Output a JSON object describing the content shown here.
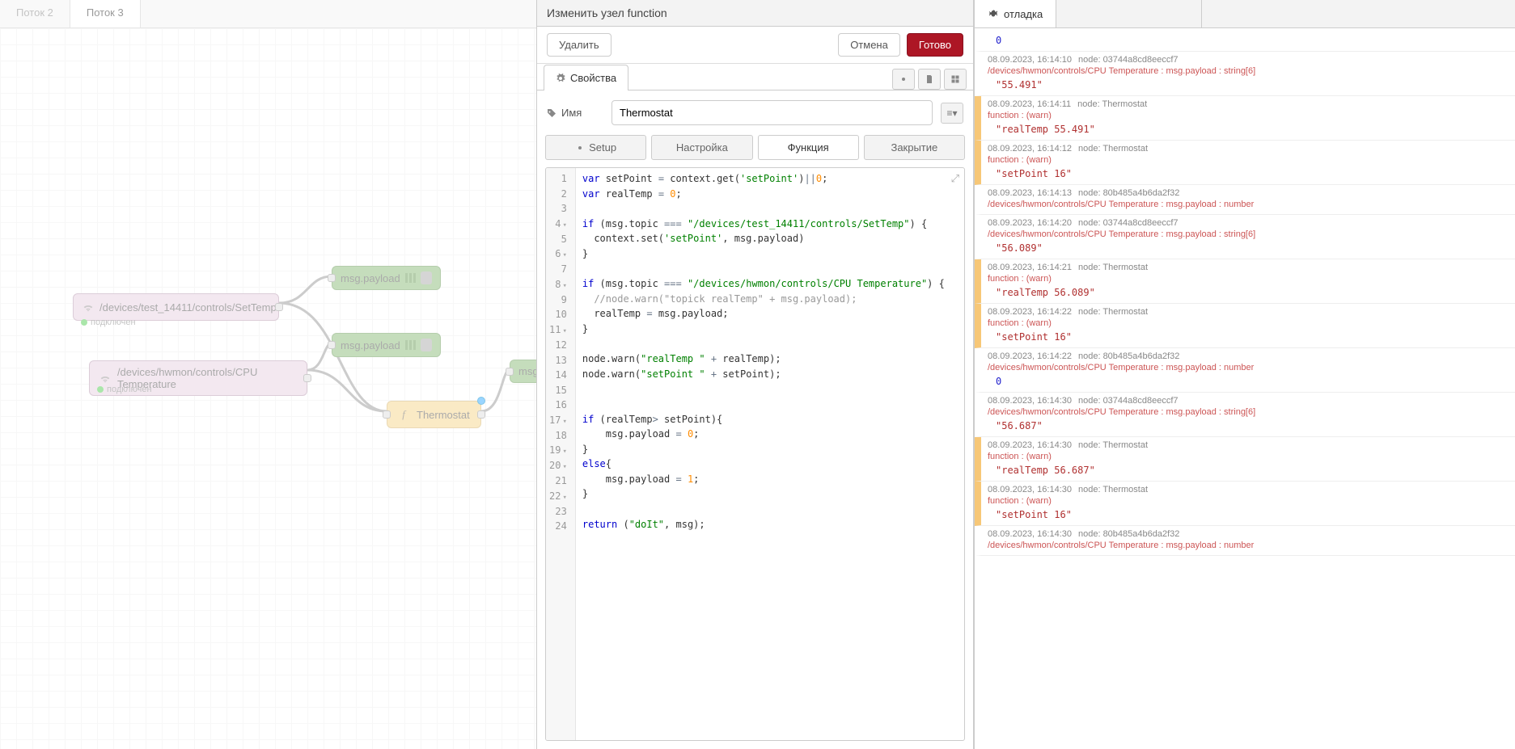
{
  "tabs_top": [
    "Поток 2",
    "Поток 3"
  ],
  "active_tab": 1,
  "canvas_nodes": {
    "n1": {
      "label": "/devices/test_14411/controls/SetTemp",
      "status": "подключен"
    },
    "n2": {
      "label": "/devices/hwmon/controls/CPU Temperature",
      "status": "подключен"
    },
    "d1": {
      "label": "msg.payload"
    },
    "d2": {
      "label": "msg.payload"
    },
    "fn": {
      "label": "Thermostat"
    },
    "d3": {
      "label": "msg"
    }
  },
  "editor": {
    "title": "Изменить узел function",
    "delete": "Удалить",
    "cancel": "Отмена",
    "done": "Готово",
    "tab_properties": "Свойства",
    "name_label": "Имя",
    "name_value": "Thermostat",
    "code_tabs": [
      "Setup",
      "Настройка",
      "Функция",
      "Закрытие"
    ],
    "code_active": 2
  },
  "code": [
    {
      "n": 1,
      "t": "<span class='kw'>var</span> setPoint <span class='op'>=</span> context.get(<span class='str'>'setPoint'</span>)<span class='op'>||</span><span class='num'>0</span>;"
    },
    {
      "n": 2,
      "t": "<span class='kw'>var</span> realTemp <span class='op'>=</span> <span class='num'>0</span>;"
    },
    {
      "n": 3,
      "t": ""
    },
    {
      "n": 4,
      "fold": true,
      "t": "<span class='kw'>if</span> (msg.topic <span class='op'>===</span> <span class='str'>\"/devices/test_14411/controls/SetTemp\"</span>) {"
    },
    {
      "n": 5,
      "t": "  context.set(<span class='str'>'setPoint'</span>, msg.payload)"
    },
    {
      "n": 6,
      "fold": true,
      "t": "}"
    },
    {
      "n": 7,
      "t": ""
    },
    {
      "n": 8,
      "fold": true,
      "t": "<span class='kw'>if</span> (msg.topic <span class='op'>===</span> <span class='str'>\"/devices/hwmon/controls/CPU Temperature\"</span>) {"
    },
    {
      "n": 9,
      "t": "  <span class='com'>//node.warn(\"topick realTemp\" + msg.payload);</span>"
    },
    {
      "n": 10,
      "t": "  realTemp <span class='op'>=</span> msg.payload;"
    },
    {
      "n": 11,
      "fold": true,
      "t": "}"
    },
    {
      "n": 12,
      "t": ""
    },
    {
      "n": 13,
      "t": "node.warn(<span class='str'>\"realTemp \"</span> <span class='op'>+</span> realTemp);"
    },
    {
      "n": 14,
      "t": "node.warn(<span class='str'>\"setPoint \"</span> <span class='op'>+</span> setPoint);"
    },
    {
      "n": 15,
      "t": ""
    },
    {
      "n": 16,
      "t": ""
    },
    {
      "n": 17,
      "fold": true,
      "t": "<span class='kw'>if</span> (realTemp<span class='op'>&gt;</span> setPoint){"
    },
    {
      "n": 18,
      "t": "    msg.payload <span class='op'>=</span> <span class='num'>0</span>;"
    },
    {
      "n": 19,
      "fold": true,
      "t": "}"
    },
    {
      "n": 20,
      "fold": true,
      "t": "<span class='kw'>else</span>{"
    },
    {
      "n": 21,
      "t": "    msg.payload <span class='op'>=</span> <span class='num'>1</span>;"
    },
    {
      "n": 22,
      "fold": true,
      "t": "}"
    },
    {
      "n": 23,
      "t": ""
    },
    {
      "n": 24,
      "t": "<span class='kw'>return</span> (<span class='str'>\"doIt\"</span>, msg);"
    }
  ],
  "debug_tab": "отладка",
  "debug": [
    {
      "warn": false,
      "ts": "",
      "node": "",
      "src": "",
      "val": "0",
      "vt": "num"
    },
    {
      "warn": false,
      "ts": "08.09.2023, 16:14:10",
      "node": "node: 03744a8cd8eeccf7",
      "src": "/devices/hwmon/controls/CPU Temperature : msg.payload : string[6]",
      "val": "\"55.491\"",
      "vt": "str"
    },
    {
      "warn": true,
      "ts": "08.09.2023, 16:14:11",
      "node": "node: Thermostat",
      "src": "function : (warn)",
      "val": "\"realTemp 55.491\"",
      "vt": "str"
    },
    {
      "warn": true,
      "ts": "08.09.2023, 16:14:12",
      "node": "node: Thermostat",
      "src": "function : (warn)",
      "val": "\"setPoint 16\"",
      "vt": "str"
    },
    {
      "warn": false,
      "ts": "08.09.2023, 16:14:13",
      "node": "node: 80b485a4b6da2f32",
      "src": "/devices/hwmon/controls/CPU Temperature : msg.payload : number",
      "val": "",
      "vt": ""
    },
    {
      "warn": false,
      "ts": "08.09.2023, 16:14:20",
      "node": "node: 03744a8cd8eeccf7",
      "src": "/devices/hwmon/controls/CPU Temperature : msg.payload : string[6]",
      "val": "\"56.089\"",
      "vt": "str"
    },
    {
      "warn": true,
      "ts": "08.09.2023, 16:14:21",
      "node": "node: Thermostat",
      "src": "function : (warn)",
      "val": "\"realTemp 56.089\"",
      "vt": "str"
    },
    {
      "warn": true,
      "ts": "08.09.2023, 16:14:22",
      "node": "node: Thermostat",
      "src": "function : (warn)",
      "val": "\"setPoint 16\"",
      "vt": "str"
    },
    {
      "warn": false,
      "ts": "08.09.2023, 16:14:22",
      "node": "node: 80b485a4b6da2f32",
      "src": "/devices/hwmon/controls/CPU Temperature : msg.payload : number",
      "val": "0",
      "vt": "num"
    },
    {
      "warn": false,
      "ts": "08.09.2023, 16:14:30",
      "node": "node: 03744a8cd8eeccf7",
      "src": "/devices/hwmon/controls/CPU Temperature : msg.payload : string[6]",
      "val": "\"56.687\"",
      "vt": "str"
    },
    {
      "warn": true,
      "ts": "08.09.2023, 16:14:30",
      "node": "node: Thermostat",
      "src": "function : (warn)",
      "val": "\"realTemp 56.687\"",
      "vt": "str"
    },
    {
      "warn": true,
      "ts": "08.09.2023, 16:14:30",
      "node": "node: Thermostat",
      "src": "function : (warn)",
      "val": "\"setPoint 16\"",
      "vt": "str"
    },
    {
      "warn": false,
      "ts": "08.09.2023, 16:14:30",
      "node": "node: 80b485a4b6da2f32",
      "src": "/devices/hwmon/controls/CPU Temperature : msg.payload : number",
      "val": "",
      "vt": ""
    }
  ]
}
